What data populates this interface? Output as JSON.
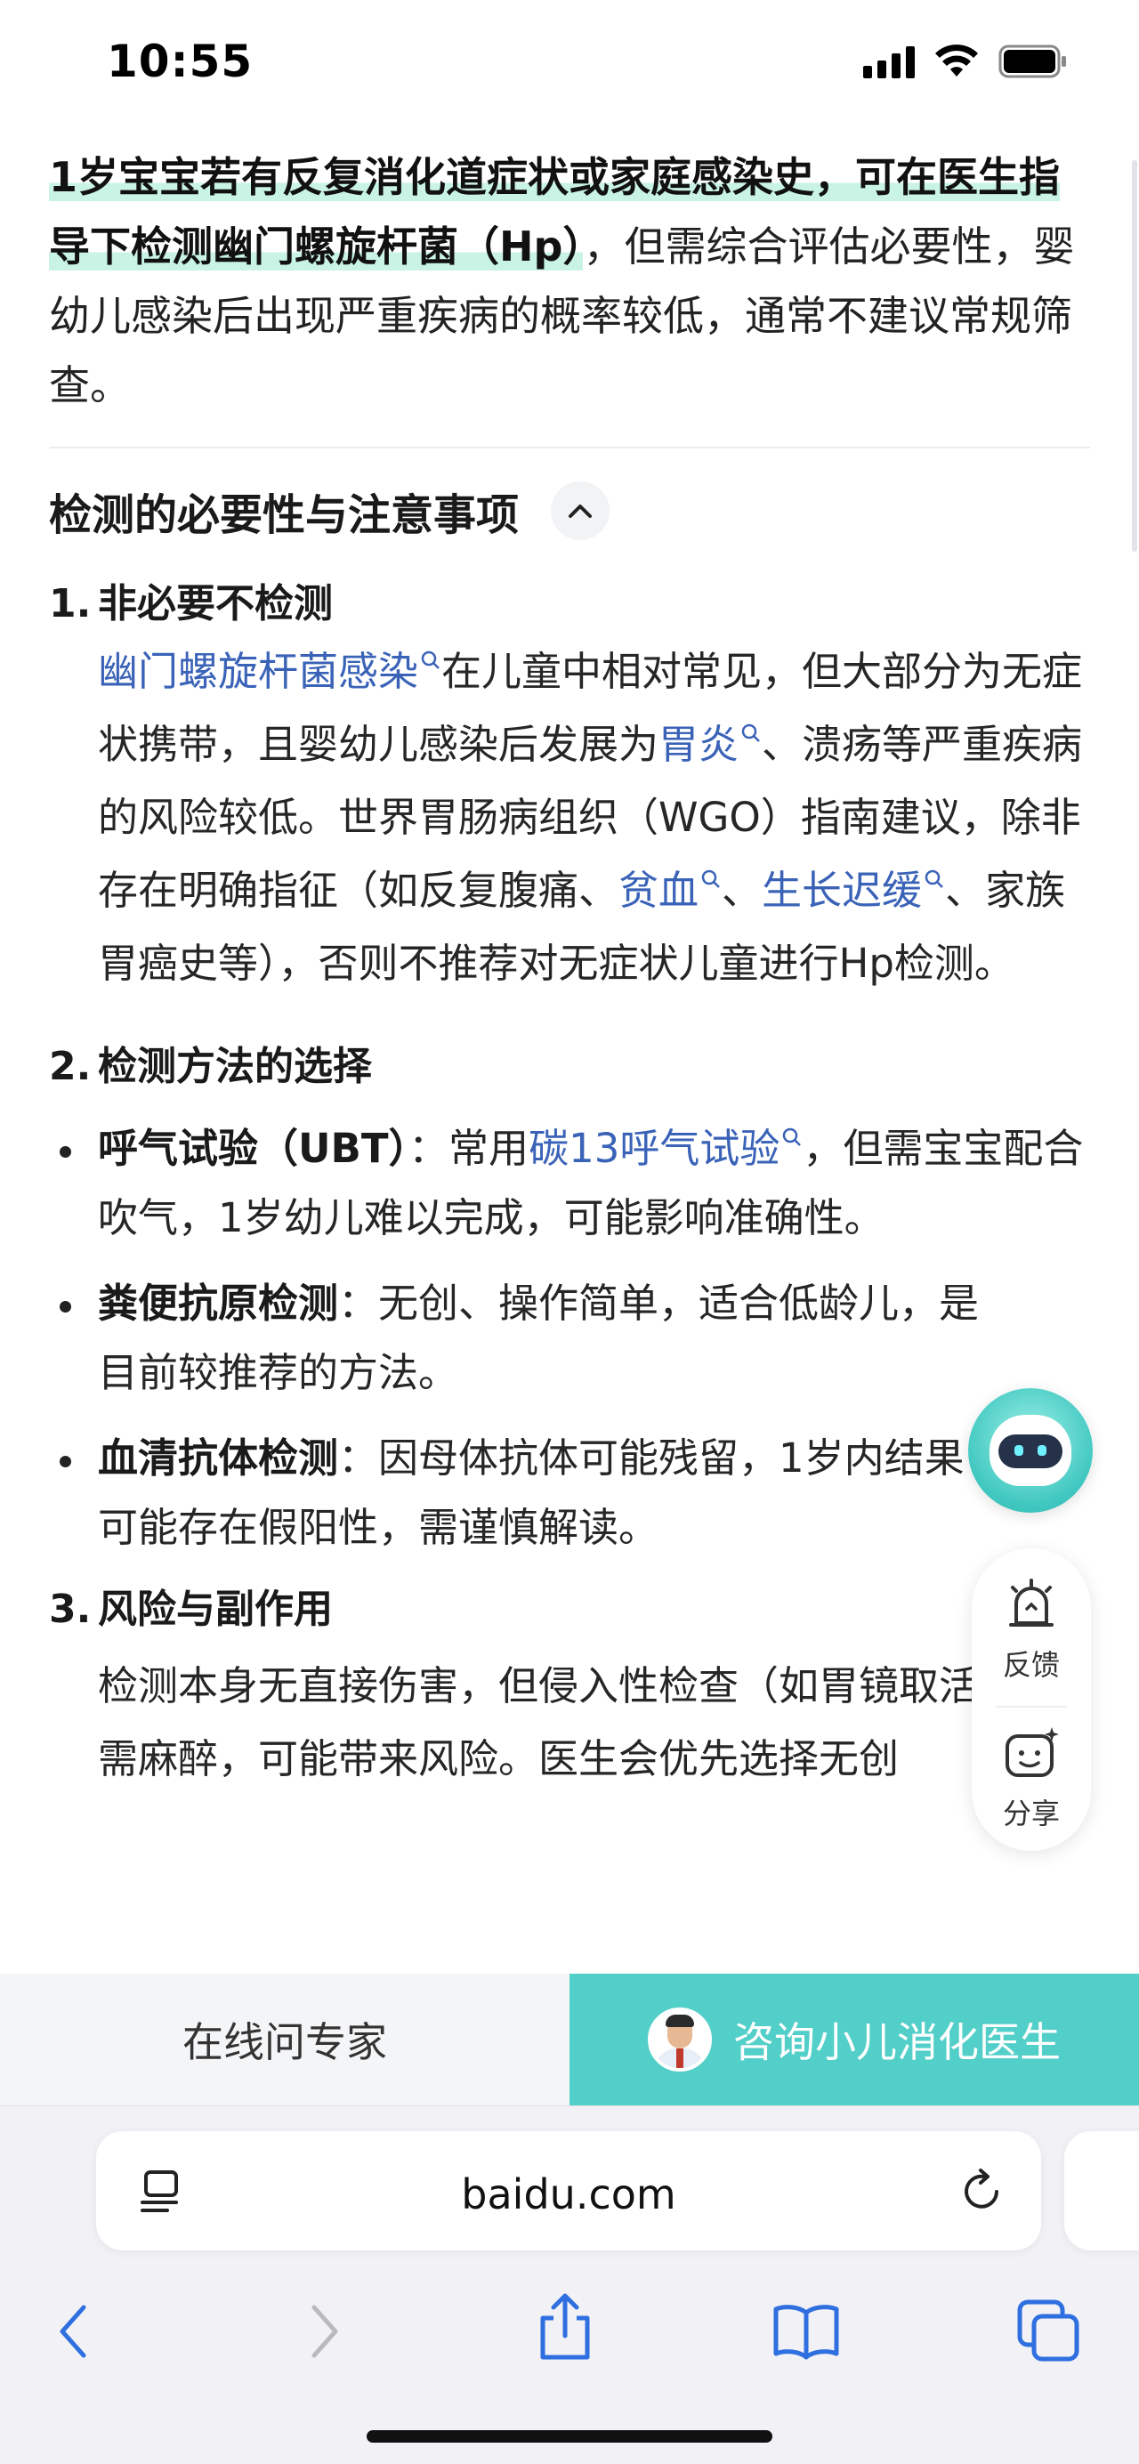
{
  "status_bar": {
    "time": "10:55"
  },
  "article": {
    "lead_highlight": "1岁宝宝若有反复消化道症状或家庭感染史，可在医生指导下检测幽门螺旋杆菌（Hp）",
    "lead_rest": "，但需综合评估必要性，婴幼儿感染后出现严重疾病的概率较低，通常不建议常规筛查。",
    "section_title": "检测的必要性与注意事项",
    "items": [
      {
        "num": "1.",
        "heading": "非必要不检测",
        "link1": "幽门螺旋杆菌感染",
        "t1": "在儿童中相对常见，但大部分为无症状携带，且婴幼儿感染后发展为",
        "link2": "胃炎",
        "t2": "、溃疡等严重疾病的风险较低。世界胃肠病组织（WGO）指南建议，除非存在明确指征（如反复腹痛、",
        "link3": "贫血",
        "t3": "、",
        "link4": "生长迟缓",
        "t4": "、家族胃癌史等），否则不推荐对无症状儿童进行Hp检测。"
      },
      {
        "num": "2.",
        "heading": "检测方法的选择",
        "bullets": [
          {
            "label": "呼气试验（UBT）",
            "sep": "：常用",
            "link": "碳13呼气试验",
            "text": "，但需宝宝配合吹气，1岁幼儿难以完成，可能影响准确性。"
          },
          {
            "label": "粪便抗原检测",
            "sep": "：",
            "link": "",
            "text": "无创、操作简单，适合低龄儿，是目前较推荐的方法。"
          },
          {
            "label": "血清抗体检测",
            "sep": "：",
            "link": "",
            "text": "因母体抗体可能残留，1岁内结果可能存在假阳性，需谨慎解读。"
          }
        ]
      },
      {
        "num": "3.",
        "heading": "风险与副作用",
        "text": "检测本身无直接伤害，但侵入性检查（如胃镜取活检）需麻醉，可能带来风险。医生会优先选择无创"
      }
    ]
  },
  "side_panel": {
    "feedback_label": "反馈",
    "share_label": "分享"
  },
  "consult_bar": {
    "left_label": "在线问专家",
    "right_label": "咨询小儿消化医生"
  },
  "browser": {
    "url": "baidu.com"
  },
  "icons": {
    "collapse": "chevron-up-icon",
    "feedback": "bell-icon",
    "share": "share-smile-icon",
    "reader": "reader-icon",
    "reload": "reload-icon",
    "back": "back-icon",
    "forward": "forward-icon",
    "share_sheet": "share-icon",
    "bookmarks": "bookmarks-icon",
    "tabs": "tabs-icon"
  },
  "colors": {
    "accent": "#52cfc8",
    "link": "#3a63b8",
    "highlight": "#c9f3e4"
  }
}
